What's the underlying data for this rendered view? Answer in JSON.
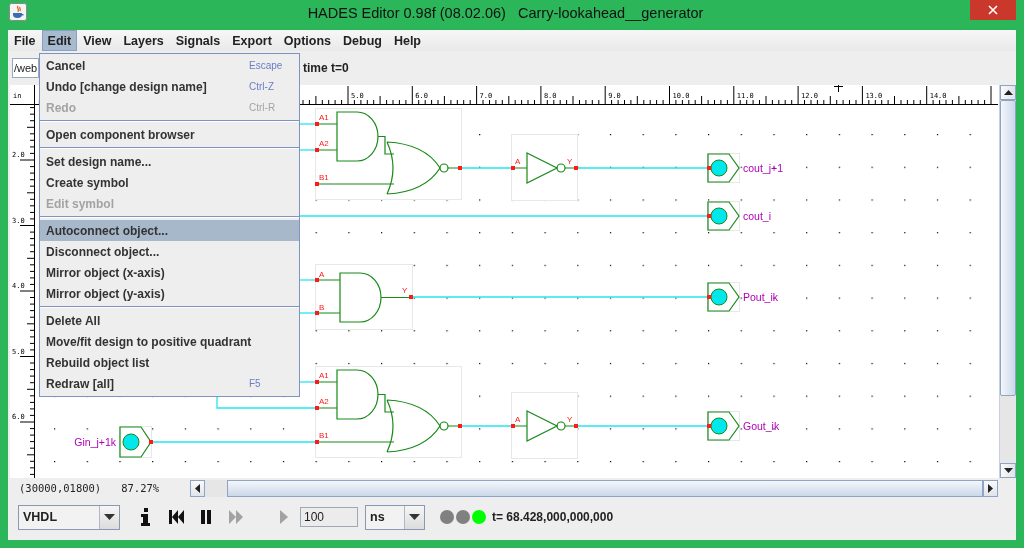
{
  "window": {
    "title": "HADES Editor 0.98f (08.02.06)   Carry-lookahead__generator"
  },
  "menu_bar": [
    {
      "label": "File",
      "selected": false
    },
    {
      "label": "Edit",
      "selected": true
    },
    {
      "label": "View",
      "selected": false
    },
    {
      "label": "Layers",
      "selected": false
    },
    {
      "label": "Signals",
      "selected": false
    },
    {
      "label": "Export",
      "selected": false
    },
    {
      "label": "Options",
      "selected": false
    },
    {
      "label": "Debug",
      "selected": false
    },
    {
      "label": "Help",
      "selected": false
    }
  ],
  "edit_menu": [
    {
      "kind": "item",
      "label": "Cancel",
      "shortcut": "Escape",
      "disabled": false,
      "selected": false
    },
    {
      "kind": "item",
      "label": "Undo [change design name]",
      "shortcut": "Ctrl-Z",
      "disabled": false,
      "selected": false
    },
    {
      "kind": "item",
      "label": "Redo",
      "shortcut": "Ctrl-R",
      "disabled": true,
      "selected": false
    },
    {
      "kind": "separator"
    },
    {
      "kind": "item",
      "label": "Open component browser",
      "disabled": false,
      "selected": false
    },
    {
      "kind": "separator"
    },
    {
      "kind": "item",
      "label": "Set design name...",
      "disabled": false,
      "selected": false
    },
    {
      "kind": "item",
      "label": "Create symbol",
      "disabled": false,
      "selected": false
    },
    {
      "kind": "item",
      "label": "Edit symbol",
      "disabled": true,
      "selected": false
    },
    {
      "kind": "separator"
    },
    {
      "kind": "item",
      "label": "Autoconnect object...",
      "disabled": false,
      "selected": true
    },
    {
      "kind": "item",
      "label": "Disconnect object...",
      "disabled": false,
      "selected": false
    },
    {
      "kind": "item",
      "label": "Mirror object (x-axis)",
      "disabled": false,
      "selected": false
    },
    {
      "kind": "item",
      "label": "Mirror object (y-axis)",
      "disabled": false,
      "selected": false
    },
    {
      "kind": "separator"
    },
    {
      "kind": "item",
      "label": "Delete All",
      "disabled": false,
      "selected": false
    },
    {
      "kind": "item",
      "label": "Move/fit design to positive quadrant",
      "disabled": false,
      "selected": false
    },
    {
      "kind": "item",
      "label": "Rebuild object list",
      "disabled": false,
      "selected": false
    },
    {
      "kind": "item",
      "label": "Redraw [all]",
      "shortcut": "F5",
      "disabled": false,
      "selected": false
    }
  ],
  "toolbar": {
    "path_field": "/web",
    "status": "time t=0"
  },
  "rulers": {
    "unit": "in",
    "top_labels": [
      "5.0",
      "6.0",
      "7.0",
      "8.0",
      "9.0",
      "10.0",
      "11.0",
      "12.0",
      "13.0",
      "14.0"
    ],
    "left_labels": [
      "2.0",
      "3.0",
      "4.0",
      "5.0",
      "6.0"
    ]
  },
  "schematic": {
    "components": [
      {
        "kind": "and-nor",
        "pins": [
          "A1",
          "A2",
          "B1"
        ]
      },
      {
        "kind": "inverter",
        "pins": [
          "A",
          "Y"
        ]
      },
      {
        "kind": "output",
        "label": "cout_j+1"
      },
      {
        "kind": "output",
        "label": "cout_i"
      },
      {
        "kind": "and",
        "pins": [
          "A",
          "B",
          "Y"
        ]
      },
      {
        "kind": "output",
        "label": "Pout_ik"
      },
      {
        "kind": "and-nor",
        "pins": [
          "A1",
          "A2",
          "B1"
        ]
      },
      {
        "kind": "inverter",
        "pins": [
          "A",
          "Y"
        ]
      },
      {
        "kind": "output",
        "label": "Gout_ik"
      },
      {
        "kind": "input",
        "label": "Gin_j+1k"
      }
    ]
  },
  "status_bar": {
    "coordinates": "(30000,01800)",
    "zoom": "87.27%"
  },
  "controls": {
    "language": "VHDL",
    "buttons": [
      {
        "kind": "info",
        "disabled": false
      },
      {
        "kind": "rewind",
        "disabled": false
      },
      {
        "kind": "pause",
        "disabled": false
      },
      {
        "kind": "fast-forward",
        "disabled": true
      },
      {
        "kind": "play",
        "disabled": true
      }
    ],
    "step_value": "100",
    "time_unit": "ns",
    "leds": [
      {
        "color": "#808080"
      },
      {
        "color": "#808080"
      },
      {
        "color": "#00ff00"
      }
    ],
    "time": "t= 68.428,000,000,000"
  }
}
